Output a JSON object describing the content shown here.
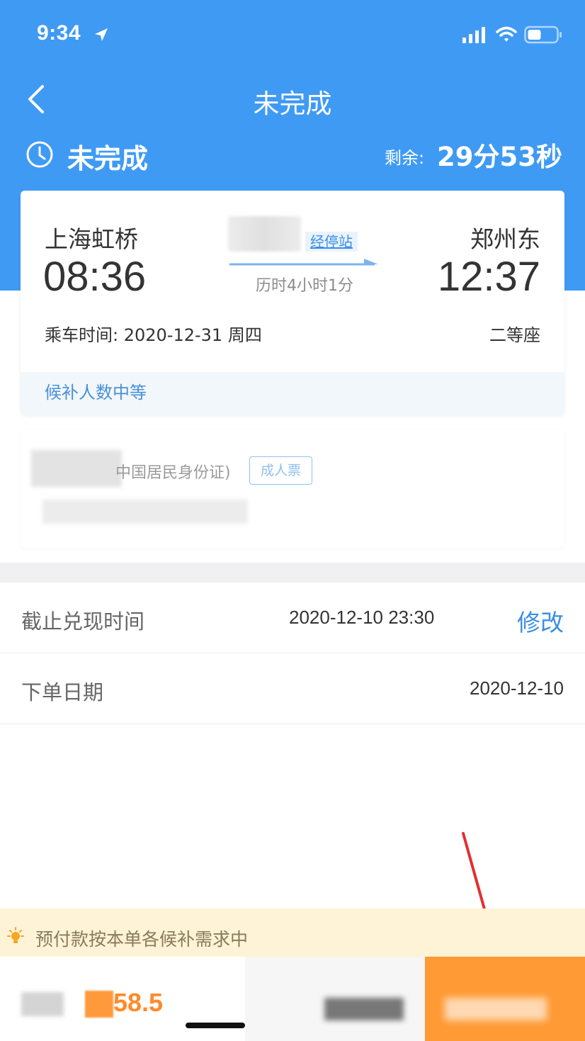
{
  "status_bar": {
    "time": "9:34"
  },
  "nav": {
    "title": "未完成"
  },
  "order_status": {
    "title": "未完成",
    "remaining_label": "剩余:",
    "remaining_value": "29分53秒"
  },
  "trip": {
    "departure_station": "上海虹桥",
    "departure_time": "08:36",
    "arrival_station": "郑州东",
    "arrival_time": "12:37",
    "stops_link": "经停站",
    "duration": "历时4小时1分",
    "ride_time": "乘车时间: 2020-12-31 周四",
    "seat_type": "二等座",
    "waitlist_level": "候补人数中等"
  },
  "passenger": {
    "id_type": "中国居民身份证)",
    "ticket_kind": "成人票"
  },
  "details": {
    "deadline_label": "截止兑现时间",
    "deadline_value": "2020-12-10 23:30",
    "modify_label": "修改",
    "order_date_label": "下单日期",
    "order_date_value": "2020-12-10"
  },
  "notice": {
    "text": "预付款按本单各候补需求中"
  },
  "footer": {
    "price_partial": "58.5"
  },
  "colors": {
    "header_blue": "#3f9af4",
    "link_blue": "#3a8ee6",
    "accent_orange": "#ff9a35",
    "notice_bg": "#fef3d6"
  }
}
